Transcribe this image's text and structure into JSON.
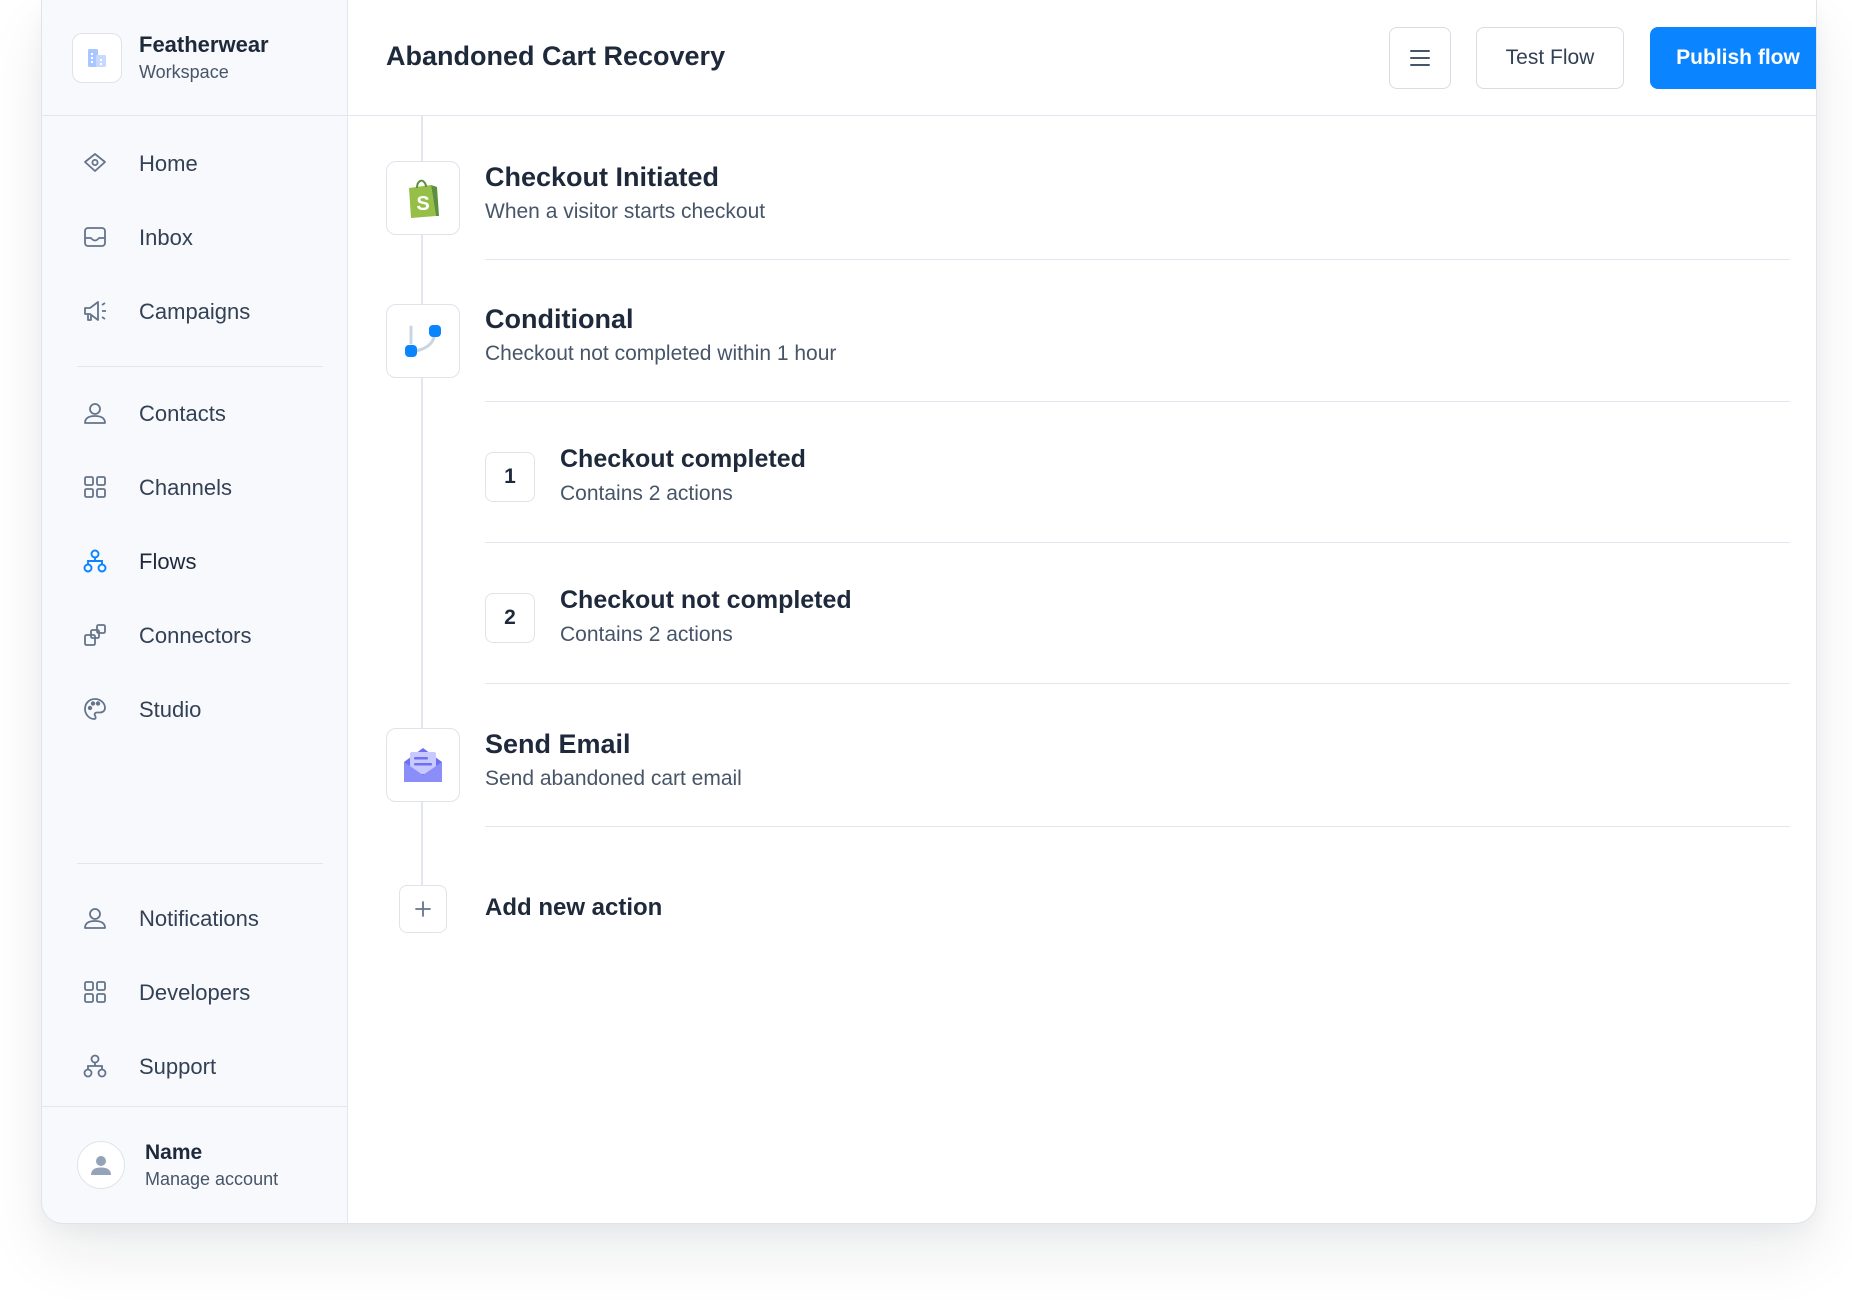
{
  "workspace": {
    "name": "Featherwear",
    "subtitle": "Workspace",
    "icon": "building-icon"
  },
  "sidebar": {
    "primary": [
      {
        "label": "Home",
        "icon": "home-icon"
      },
      {
        "label": "Inbox",
        "icon": "inbox-icon"
      },
      {
        "label": "Campaigns",
        "icon": "megaphone-icon"
      }
    ],
    "secondary": [
      {
        "label": "Contacts",
        "icon": "user-icon"
      },
      {
        "label": "Channels",
        "icon": "grid-icon"
      },
      {
        "label": "Flows",
        "icon": "flow-icon",
        "active": true
      },
      {
        "label": "Connectors",
        "icon": "connector-icon"
      },
      {
        "label": "Studio",
        "icon": "palette-icon"
      }
    ],
    "bottom": [
      {
        "label": "Notifications",
        "icon": "user-icon"
      },
      {
        "label": "Developers",
        "icon": "grid-icon"
      },
      {
        "label": "Support",
        "icon": "flow-icon"
      }
    ]
  },
  "account": {
    "name": "Name",
    "subtitle": "Manage account"
  },
  "header": {
    "title": "Abandoned Cart Recovery",
    "test_label": "Test Flow",
    "publish_label": "Publish flow"
  },
  "flow": {
    "trigger": {
      "title": "Checkout Initiated",
      "subtitle": "When a visitor starts checkout",
      "icon": "shopify-bag-icon"
    },
    "conditional": {
      "title": "Conditional",
      "subtitle": "Checkout not completed within 1 hour",
      "icon": "branch-icon"
    },
    "branches": [
      {
        "number": "1",
        "title": "Checkout completed",
        "subtitle": "Contains 2 actions"
      },
      {
        "number": "2",
        "title": "Checkout not completed",
        "subtitle": "Contains 2 actions"
      }
    ],
    "email": {
      "title": "Send Email",
      "subtitle": "Send abandoned cart email",
      "icon": "envelope-icon"
    },
    "add_action_label": "Add new action"
  },
  "colors": {
    "accent": "#0b84ff",
    "shopify": "#95bf47",
    "email": "#7c7ff5"
  }
}
